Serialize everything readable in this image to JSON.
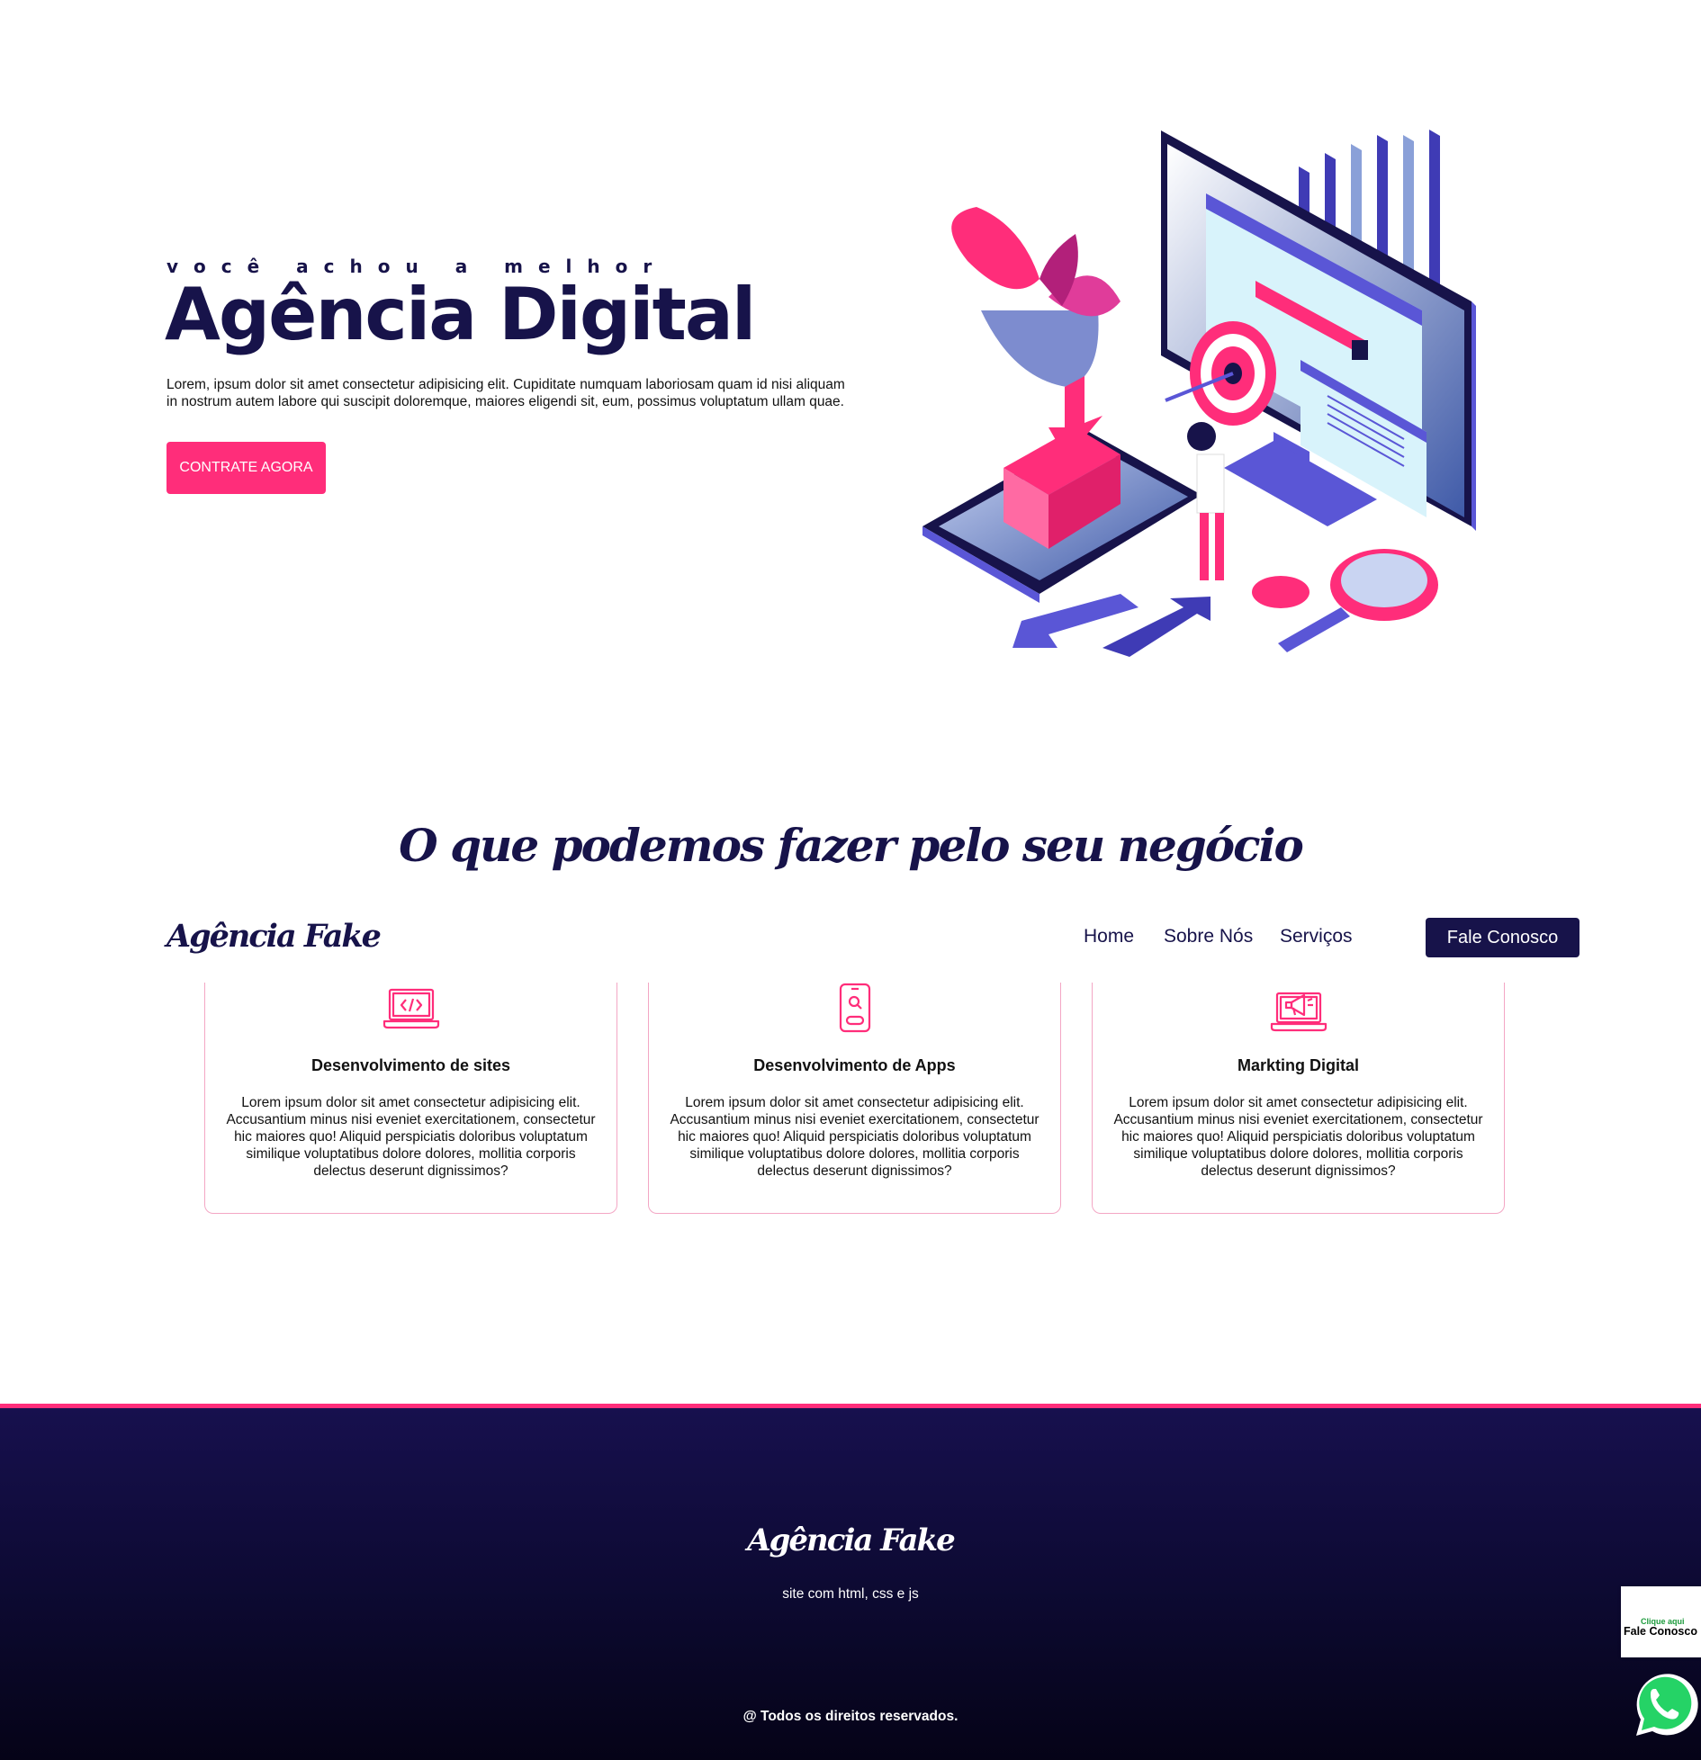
{
  "hero": {
    "tagline": "você achou a melhor",
    "title": "Agência Digital",
    "text": "Lorem, ipsum dolor sit amet consectetur adipisicing elit. Cupiditate numquam laboriosam quam id nisi aliquam in nostrum autem labore qui suscipit doloremque, maiores eligendi sit, eum, possimus voluptatum ullam quae.",
    "cta_label": "CONTRATE AGORA",
    "illustration_icon": "digital-marketing-isometric-illustration"
  },
  "services": {
    "heading": "O que podemos fazer pelo seu negócio",
    "cards": [
      {
        "icon": "laptop-code-icon",
        "title": "Desenvolvimento de sites",
        "text": "Lorem ipsum dolor sit amet consectetur adipisicing elit. Accusantium minus nisi eveniet exercitationem, consectetur hic maiores quo! Aliquid perspiciatis doloribus voluptatum similique voluptatibus dolore dolores, mollitia corporis delectus deserunt dignissimos?"
      },
      {
        "icon": "smartphone-search-icon",
        "title": "Desenvolvimento de Apps",
        "text": "Lorem ipsum dolor sit amet consectetur adipisicing elit. Accusantium minus nisi eveniet exercitationem, consectetur hic maiores quo! Aliquid perspiciatis doloribus voluptatum similique voluptatibus dolore dolores, mollitia corporis delectus deserunt dignissimos?"
      },
      {
        "icon": "laptop-megaphone-icon",
        "title": "Markting Digital",
        "text": "Lorem ipsum dolor sit amet consectetur adipisicing elit. Accusantium minus nisi eveniet exercitationem, consectetur hic maiores quo! Aliquid perspiciatis doloribus voluptatum similique voluptatibus dolore dolores, mollitia corporis delectus deserunt dignissimos?"
      }
    ]
  },
  "nav": {
    "brand": "Agência Fake",
    "links": [
      "Home",
      "Sobre Nós",
      "Serviços"
    ],
    "contact_label": "Fale Conosco"
  },
  "footer": {
    "brand": "Agência Fake",
    "subtitle": "site com html, css e js",
    "copyright": "@ Todos os direitos reservados."
  },
  "whatsapp": {
    "small_label": "Clique aqui",
    "big_label": "Fale Conosco",
    "icon": "whatsapp-icon"
  },
  "colors": {
    "primary": "#17134a",
    "accent": "#ff2d7a",
    "card_border": "#f3a6c4",
    "whatsapp_green": "#25d366"
  }
}
